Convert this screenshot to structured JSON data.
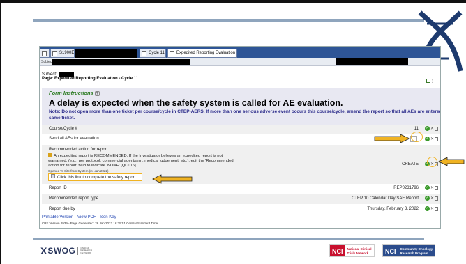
{
  "slide": {
    "logo_swog_text": "SWOG",
    "logo_swog_small": [
      "CANCER",
      "RESEARCH",
      "NETWORK"
    ],
    "nci_1": {
      "mark": "NCI",
      "text": [
        "National Clinical",
        "Trials Network"
      ]
    },
    "nci_2": {
      "mark": "NCI",
      "text": [
        "Community Oncology",
        "Research Program"
      ]
    }
  },
  "app": {
    "tabs": [
      {
        "label": "S1900E"
      },
      {
        "label": "Cycle 11"
      },
      {
        "label": "Expedited Reporting Evaluation"
      }
    ],
    "subject_bar_label": "Subject",
    "subject_label": "Subject:",
    "page_label": "Page: Expedited Reporting Evaluation - Cycle 11",
    "form_instructions": "Form Instructions",
    "help_glyph": "?",
    "big_title": "A delay is expected when the safety system is called for AE evaluation.",
    "note": "Note: Do not open more than one ticket per course/cycle in CTEP-AERS. If more than one serious adverse event occurs this course/cycle, amend the report so that all AEs are entered on the same ticket.",
    "rows": [
      {
        "label": "Course/Cycle #",
        "value": "11"
      },
      {
        "label": "Send all AEs for evaluation",
        "value": ""
      },
      {
        "label": "Recommended action for report",
        "value": "CREATE"
      },
      {
        "label": "Report ID",
        "value": "REP0231796"
      },
      {
        "label": "Recommended report type",
        "value": "CTEP 10 Calendar Day SAE Report"
      },
      {
        "label": "Report due by",
        "value": "Thursday, February 3, 2022"
      }
    ],
    "rec_detail": "An expedited report is RECOMMENDED. If the Investigator believes an expedited report is not warranted, (e.g., per protocol, commercial agent/arm, medical judgement, etc.), edit the 'Recommended action for report' field to indicate 'NONE' [QC016]",
    "opened_note": "Opened To Site from System (24 Jan 2022)",
    "safety_link": "Click this link to complete the safety report",
    "footer_links": [
      "Printable Version",
      "View PDF",
      "Icon Key"
    ],
    "crf_version": "CRF Version 2939 - Page Generated: 26 Jan 2022 16:35:51 Central Standard Time"
  },
  "colors": {
    "tab_bar": "#2e5596",
    "annotation": "#f0b323",
    "title_rule": "#8fa5bd",
    "form_instr": "#2a7a20",
    "note": "#2a2a8a"
  }
}
